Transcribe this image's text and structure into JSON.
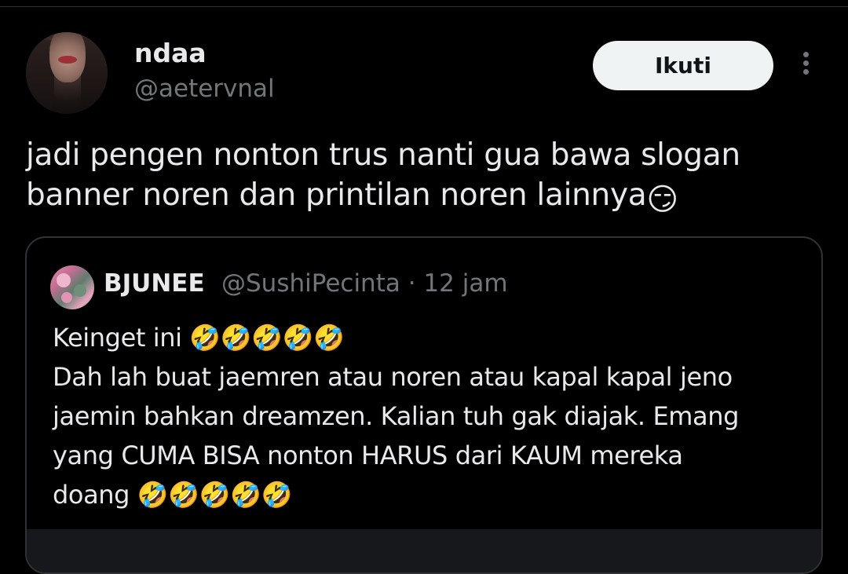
{
  "post": {
    "author": {
      "display_name": "ndaa",
      "handle": "@aetervnal"
    },
    "follow_label": "Ikuti",
    "more_icon": "more-vertical-icon",
    "text_line1": "jadi pengen nonton trus nanti gua bawa slogan",
    "text_line2": "banner noren dan printilan noren lainnya",
    "text_emoji": "😏"
  },
  "quote": {
    "author": {
      "display_name": "BJUNEE",
      "handle": "@SushiPecinta",
      "timestamp": "12 jam"
    },
    "separator": " · ",
    "lines": [
      "Keinget ini 🤣🤣🤣🤣🤣",
      "Dah lah buat jaemren atau noren atau kapal kapal jeno",
      "jaemin bahkan dreamzen. Kalian tuh gak diajak. Emang",
      "yang CUMA BISA nonton HARUS dari KAUM mereka",
      "doang 🤣🤣🤣🤣🤣"
    ]
  },
  "colors": {
    "background": "#000000",
    "primary_text": "#e7e9ea",
    "secondary_text": "#71767b",
    "border": "#2f3336",
    "button_bg": "#eff3f4"
  }
}
